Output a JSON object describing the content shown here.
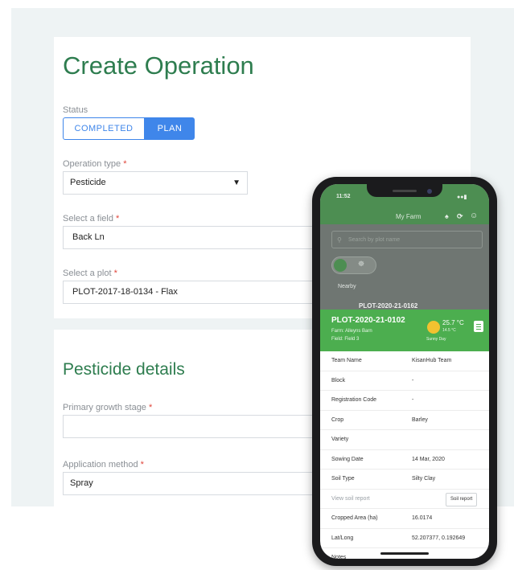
{
  "form": {
    "title": "Create Operation",
    "status_label": "Status",
    "status_options": [
      "COMPLETED",
      "PLAN"
    ],
    "status_selected": "PLAN",
    "operation_type_label": "Operation type",
    "operation_type_value": "Pesticide",
    "field_label": "Select a field",
    "field_value": "Back Ln",
    "plot_label": "Select a plot",
    "plot_value": "PLOT-2017-18-0134 - Flax",
    "required_mark": "*",
    "details_title": "Pesticide details",
    "growth_stage_label": "Primary growth stage",
    "growth_stage_value": "",
    "application_method_label": "Application method",
    "application_method_value": "Spray"
  },
  "phone": {
    "status_time": "11:52",
    "header_title": "My Farm",
    "search_placeholder": "Search by plot name",
    "nearby_label": "Nearby",
    "dimmed_plot": "PLOT-2020-21-0162",
    "plot_id": "PLOT-2020-21-0102",
    "farm_line": "Farm: Alleyns Barn",
    "field_line": "Field: Field 3",
    "temperature": "25.7 °C",
    "temperature_sub": "14.5 °C",
    "weather_desc": "Sunny Day",
    "details": [
      {
        "key": "Team Name",
        "value": "KisanHub Team"
      },
      {
        "key": "Block",
        "value": "-"
      },
      {
        "key": "Registration Code",
        "value": "-"
      },
      {
        "key": "Crop",
        "value": "Barley"
      },
      {
        "key": "Variety",
        "value": ""
      },
      {
        "key": "Sowing Date",
        "value": "14 Mar, 2020"
      },
      {
        "key": "Soil Type",
        "value": "Silty Clay"
      }
    ],
    "view_soil_report": "View soil report",
    "soil_report_button": "Soil report",
    "details2": [
      {
        "key": "Cropped Area (ha)",
        "value": "16.0174"
      },
      {
        "key": "Lat/Long",
        "value": "52.207377, 0.192649"
      },
      {
        "key": "Notes",
        "value": ""
      }
    ],
    "colors": {
      "header_green": "#4d8e52",
      "card_green": "#4cae4f",
      "sun": "#f2c230"
    }
  },
  "colors": {
    "title_green": "#2e7d4f",
    "accent_blue": "#3f86ea",
    "required_red": "#e0453a"
  }
}
